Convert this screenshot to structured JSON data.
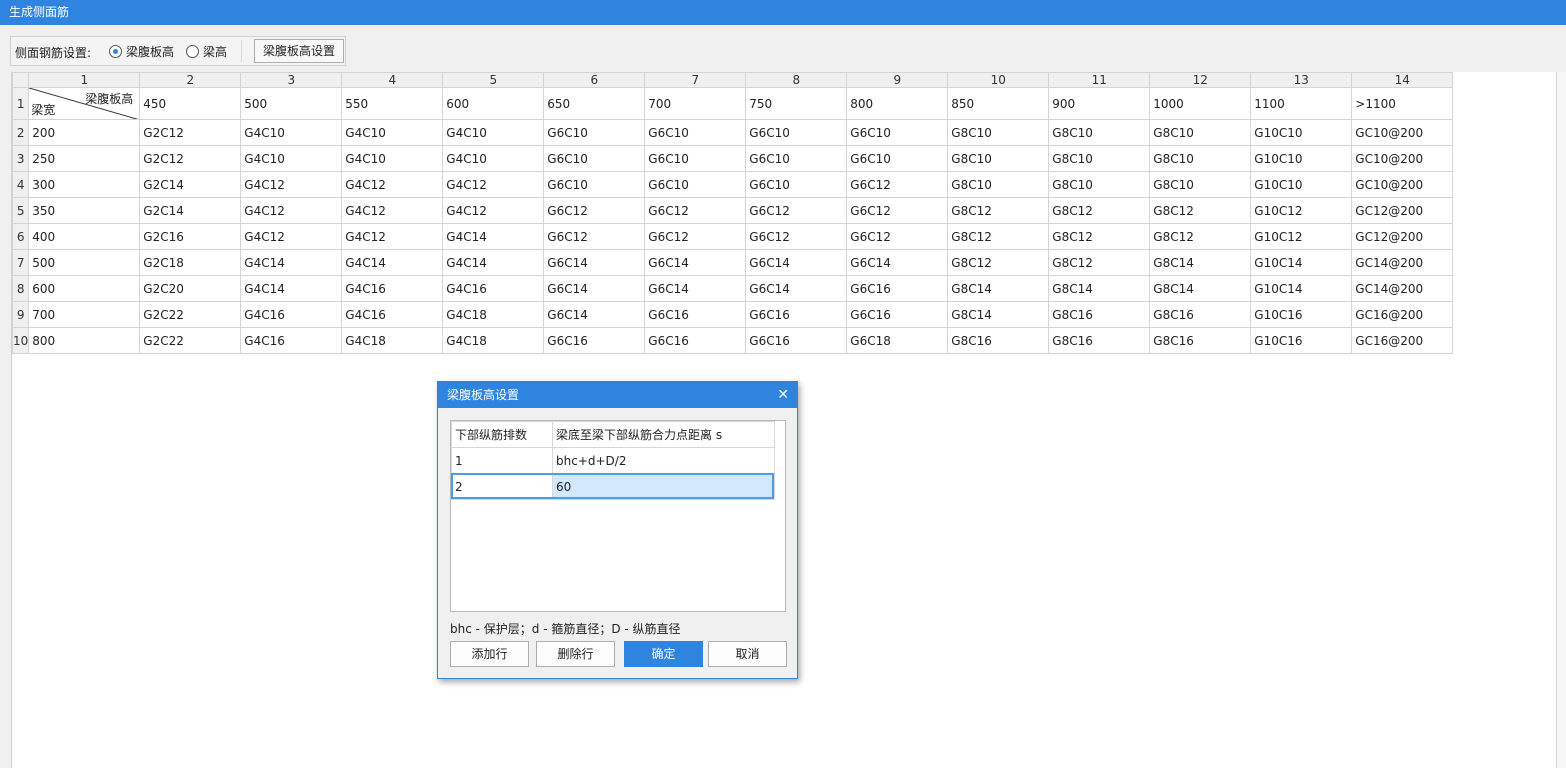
{
  "window": {
    "title": "生成侧面筋"
  },
  "toolbar": {
    "label": "侧面钢筋设置:",
    "radio_web_height": "梁腹板高",
    "radio_beam_height": "梁高",
    "settings_button": "梁腹板高设置",
    "selected": "梁腹板高"
  },
  "grid": {
    "col_numbers": [
      "1",
      "2",
      "3",
      "4",
      "5",
      "6",
      "7",
      "8",
      "9",
      "10",
      "11",
      "12",
      "13",
      "14"
    ],
    "corner_top": "梁腹板高",
    "corner_bottom": "梁宽",
    "heights": [
      "450",
      "500",
      "550",
      "600",
      "650",
      "700",
      "750",
      "800",
      "850",
      "900",
      "1000",
      "1100",
      ">1100"
    ],
    "rows": [
      {
        "num": "2",
        "width": "200",
        "cells": [
          "G2C12",
          "G4C10",
          "G4C10",
          "G4C10",
          "G6C10",
          "G6C10",
          "G6C10",
          "G6C10",
          "G8C10",
          "G8C10",
          "G8C10",
          "G10C10",
          "GC10@200"
        ]
      },
      {
        "num": "3",
        "width": "250",
        "cells": [
          "G2C12",
          "G4C10",
          "G4C10",
          "G4C10",
          "G6C10",
          "G6C10",
          "G6C10",
          "G6C10",
          "G8C10",
          "G8C10",
          "G8C10",
          "G10C10",
          "GC10@200"
        ]
      },
      {
        "num": "4",
        "width": "300",
        "cells": [
          "G2C14",
          "G4C12",
          "G4C12",
          "G4C12",
          "G6C10",
          "G6C10",
          "G6C10",
          "G6C12",
          "G8C10",
          "G8C10",
          "G8C10",
          "G10C10",
          "GC10@200"
        ]
      },
      {
        "num": "5",
        "width": "350",
        "cells": [
          "G2C14",
          "G4C12",
          "G4C12",
          "G4C12",
          "G6C12",
          "G6C12",
          "G6C12",
          "G6C12",
          "G8C12",
          "G8C12",
          "G8C12",
          "G10C12",
          "GC12@200"
        ]
      },
      {
        "num": "6",
        "width": "400",
        "cells": [
          "G2C16",
          "G4C12",
          "G4C12",
          "G4C14",
          "G6C12",
          "G6C12",
          "G6C12",
          "G6C12",
          "G8C12",
          "G8C12",
          "G8C12",
          "G10C12",
          "GC12@200"
        ]
      },
      {
        "num": "7",
        "width": "500",
        "cells": [
          "G2C18",
          "G4C14",
          "G4C14",
          "G4C14",
          "G6C14",
          "G6C14",
          "G6C14",
          "G6C14",
          "G8C12",
          "G8C12",
          "G8C14",
          "G10C14",
          "GC14@200"
        ]
      },
      {
        "num": "8",
        "width": "600",
        "cells": [
          "G2C20",
          "G4C14",
          "G4C16",
          "G4C16",
          "G6C14",
          "G6C14",
          "G6C14",
          "G6C16",
          "G8C14",
          "G8C14",
          "G8C14",
          "G10C14",
          "GC14@200"
        ]
      },
      {
        "num": "9",
        "width": "700",
        "cells": [
          "G2C22",
          "G4C16",
          "G4C16",
          "G4C18",
          "G6C14",
          "G6C16",
          "G6C16",
          "G6C16",
          "G8C14",
          "G8C16",
          "G8C16",
          "G10C16",
          "GC16@200"
        ]
      },
      {
        "num": "10",
        "width": "800",
        "cells": [
          "G2C22",
          "G4C16",
          "G4C18",
          "G4C18",
          "G6C16",
          "G6C16",
          "G6C16",
          "G6C18",
          "G8C16",
          "G8C16",
          "G8C16",
          "G10C16",
          "GC16@200"
        ]
      }
    ]
  },
  "dialog": {
    "title": "梁腹板高设置",
    "col_rows": "下部纵筋排数",
    "col_distance": "梁底至梁下部纵筋合力点距离 s",
    "rows": [
      {
        "rows": "1",
        "distance": "bhc+d+D/2"
      },
      {
        "rows": "2",
        "distance": "60"
      }
    ],
    "note": "bhc - 保护层；d - 箍筋直径；D - 纵筋直径",
    "add_row": "添加行",
    "delete_row": "删除行",
    "ok": "确定",
    "cancel": "取消"
  }
}
